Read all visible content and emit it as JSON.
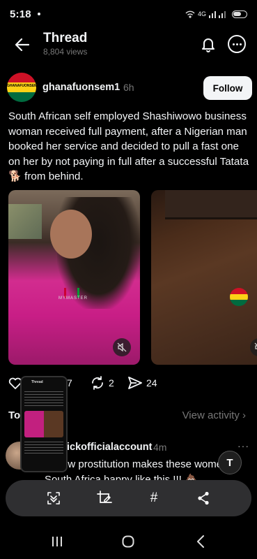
{
  "status_bar": {
    "time": "5:18",
    "network": "4G"
  },
  "header": {
    "title": "Thread",
    "views": "8,804 views"
  },
  "post": {
    "username": "ghanafuonsem1",
    "time_ago": "6h",
    "avatar_text": "GHANAFUONSEM",
    "follow_label": "Follow",
    "caption": "South African self employed Shashiwowo business woman received full payment,  after a Nigerian man booked her service and decided to pull a fast one on her by not paying in full after a successful Tatata 🐕 from behind.",
    "watermark": "MYMASTER",
    "stats": {
      "likes": "7",
      "reposts": "2",
      "shares": "24"
    }
  },
  "tabs": {
    "top_label": "To",
    "view_activity": "View activity ›"
  },
  "reply": {
    "username": "ickofficialaccount",
    "time_ago": "4m",
    "more": "···",
    "text": "r knew prostitution makes these women in South Africa happy like this !!! 💩"
  },
  "thumbnail": {
    "title": "Thread"
  },
  "text_select_label": "T",
  "toolbar": {
    "hash_label": "#"
  },
  "colors": {
    "ghana_red": "#ce1126",
    "ghana_yellow": "#fcd116",
    "ghana_green": "#006b3f",
    "toolbar_bg": "#2f2f31"
  }
}
